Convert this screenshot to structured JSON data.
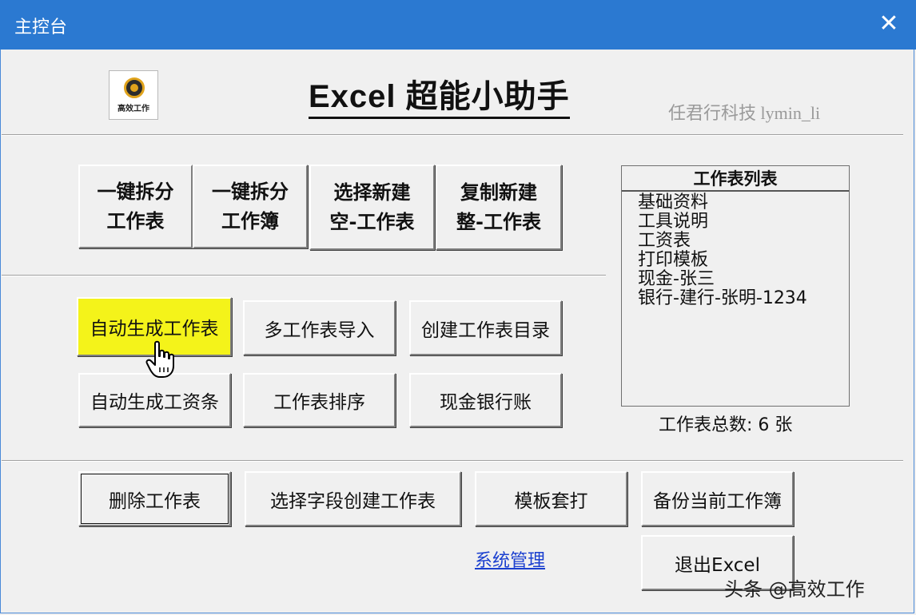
{
  "window": {
    "title": "主控台"
  },
  "header": {
    "logo_text": "高效工作",
    "app_title": "Excel 超能小助手",
    "company": "任君行科技 lymin_li"
  },
  "top_buttons": [
    {
      "line1": "一键拆分",
      "line2": "工作表"
    },
    {
      "line1": "一键拆分",
      "line2": "工作簿"
    },
    {
      "line1": "选择新建",
      "line2": "空-工作表"
    },
    {
      "line1": "复制新建",
      "line2": "整-工作表"
    }
  ],
  "middle_buttons": {
    "auto_generate_sheet": "自动生成工作表",
    "multi_sheet_import": "多工作表导入",
    "create_sheet_toc": "创建工作表目录",
    "auto_generate_payslip": "自动生成工资条",
    "sheet_sort": "工作表排序",
    "cash_bank_account": "现金银行账"
  },
  "sheet_list": {
    "header": "工作表列表",
    "items": [
      "基础资料",
      "工具说明",
      "工资表",
      "打印模板",
      "现金-张三",
      "银行-建行-张明-1234"
    ],
    "count_text": "工作表总数: 6 张"
  },
  "bottom_buttons": {
    "delete_sheet": "删除工作表",
    "select_field_create": "选择字段创建工作表",
    "template_print": "模板套打",
    "backup_workbook": "备份当前工作簿",
    "exit_excel": "退出Excel"
  },
  "system_link": "系统管理",
  "watermark": "头条 @高效工作"
}
